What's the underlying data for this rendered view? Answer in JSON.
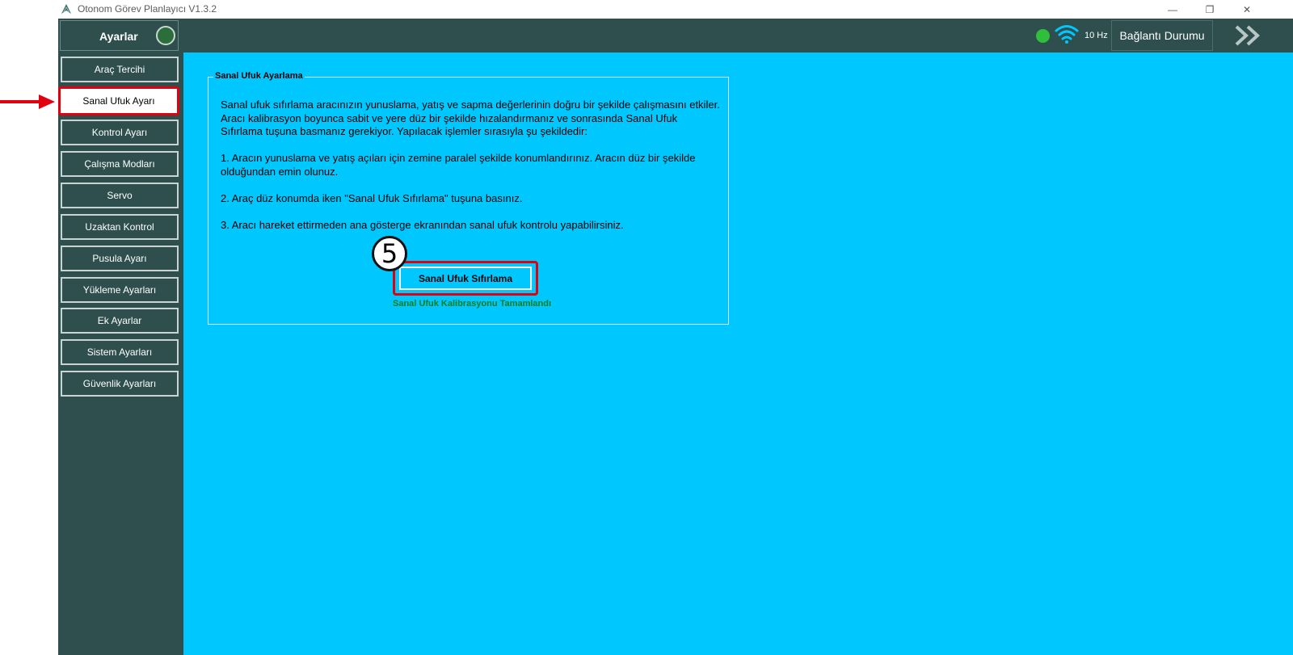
{
  "window": {
    "title": "Otonom Görev Planlayıcı V1.3.2",
    "minimize_glyph": "—",
    "restore_glyph": "❐",
    "close_glyph": "✕"
  },
  "sidebar": {
    "header": "Ayarlar",
    "items": [
      {
        "label": "Araç Tercihi"
      },
      {
        "label": "Sanal Ufuk Ayarı"
      },
      {
        "label": "Kontrol Ayarı"
      },
      {
        "label": "Çalışma Modları"
      },
      {
        "label": "Servo"
      },
      {
        "label": "Uzaktan Kontrol"
      },
      {
        "label": "Pusula Ayarı"
      },
      {
        "label": "Yükleme Ayarları"
      },
      {
        "label": "Ek Ayarlar"
      },
      {
        "label": "Sistem Ayarları"
      },
      {
        "label": "Güvenlik Ayarları"
      }
    ],
    "active_index": 1
  },
  "topbar": {
    "rate": "10 Hz",
    "connection_label": "Bağlantı Durumu",
    "status_color": "#2fbf3a"
  },
  "panel": {
    "title": "Sanal Ufuk Ayarlama",
    "intro": "Sanal ufuk sıfırlama aracınızın yunuslama, yatış ve sapma değerlerinin doğru bir şekilde çalışmasını etkiler. Aracı kalibrasyon boyunca sabit ve yere düz bir şekilde hızalandırmanız ve sonrasında Sanal Ufuk Sıfırlama tuşuna basmanız gerekiyor. Yapılacak işlemler sırasıyla şu şekildedir:",
    "step1": "1. Aracın yunuslama ve yatış açıları için zemine paralel şekilde konumlandırınız. Aracın düz bir şekilde olduğundan emin olunuz.",
    "step2": "2. Araç düz konumda iken \"Sanal Ufuk Sıfırlama\" tuşuna basınız.",
    "step3": "3. Aracı hareket ettirmeden ana gösterge ekranından sanal ufuk kontrolu yapabilirsiniz.",
    "button_label": "Sanal Ufuk Sıfırlama",
    "status_message": "Sanal Ufuk Kalibrasyonu Tamamlandı",
    "step_badge": "5"
  },
  "colors": {
    "sidebar_bg": "#2f4f4f",
    "main_bg": "#00c8ff",
    "highlight": "#e0000e"
  }
}
